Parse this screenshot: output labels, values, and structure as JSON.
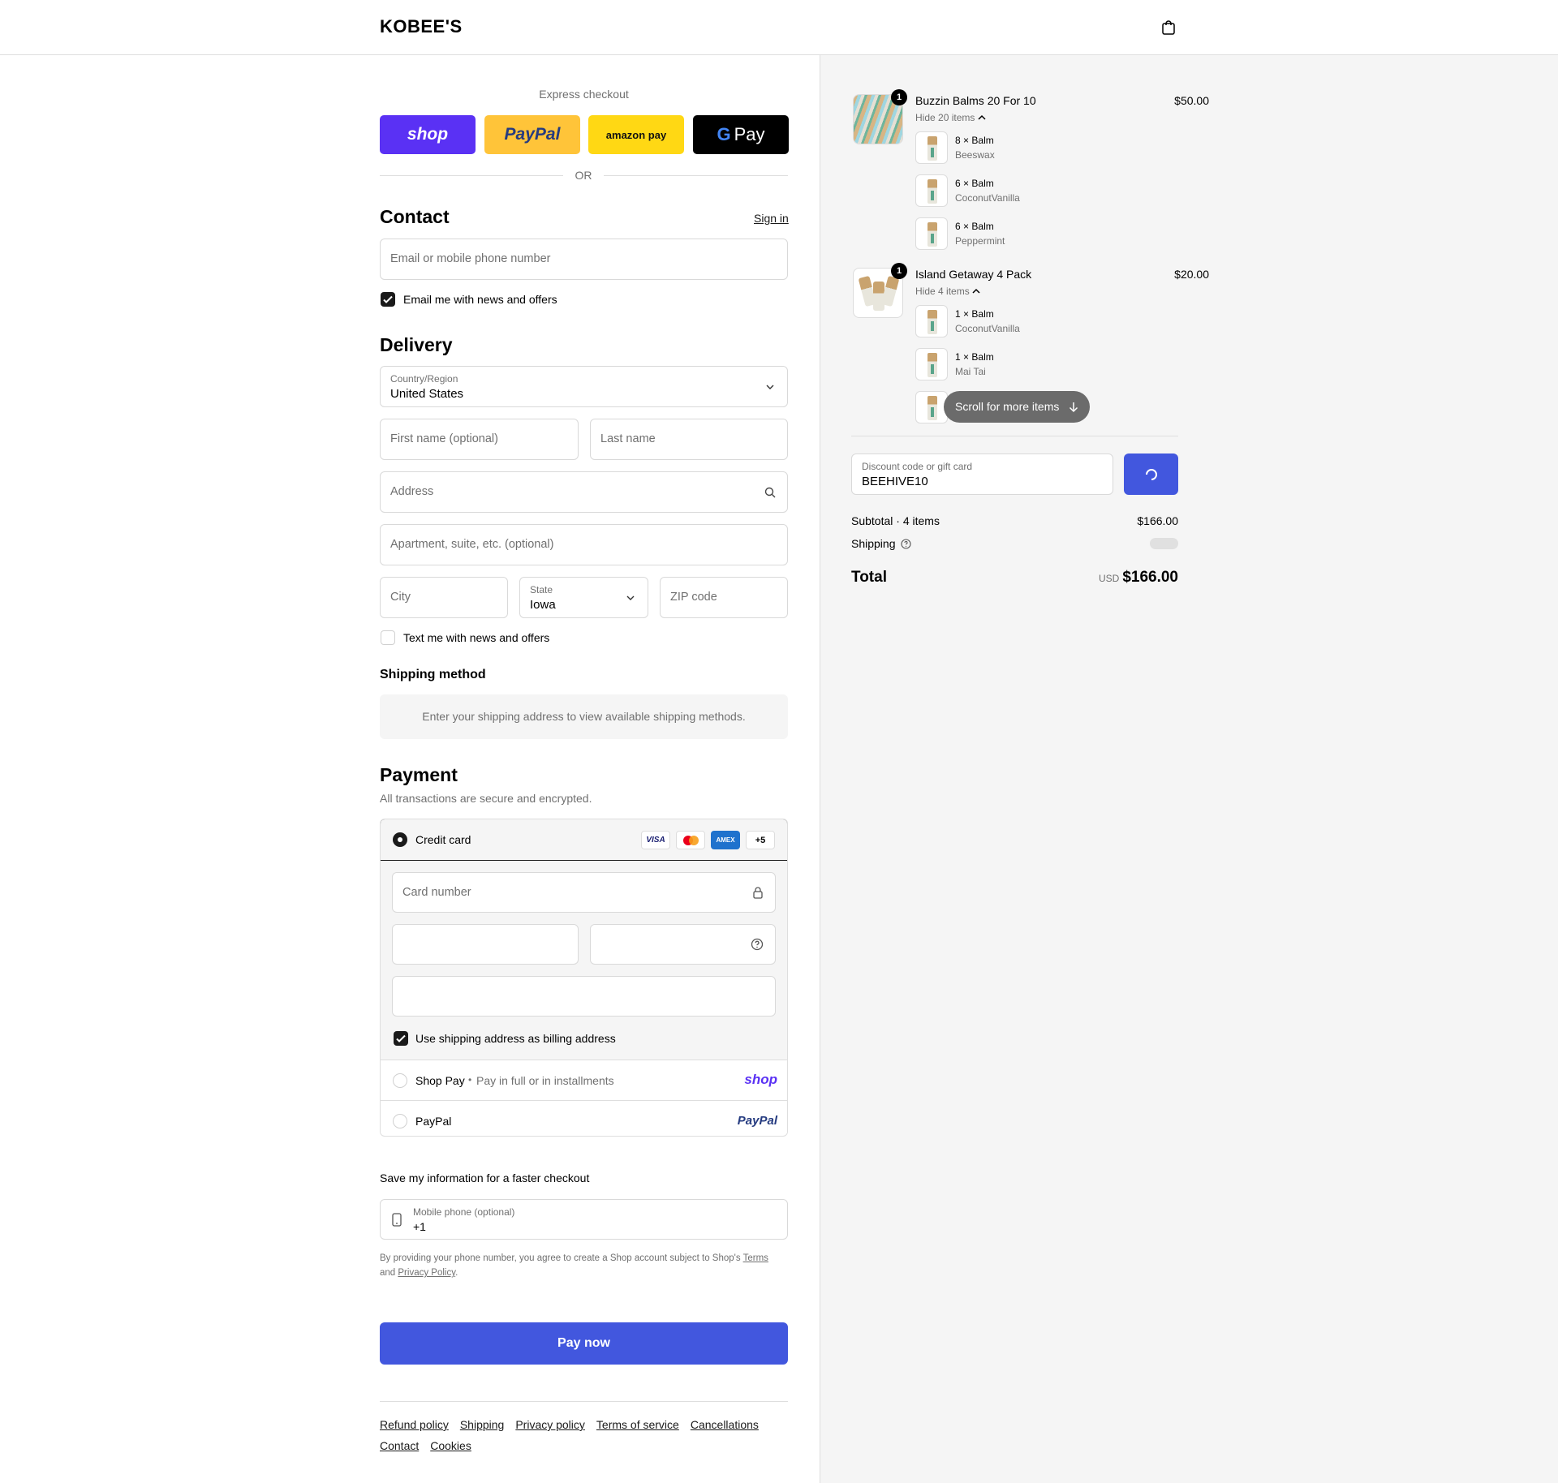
{
  "header": {
    "brand": "KOBEE'S"
  },
  "express": {
    "title": "Express checkout",
    "buttons": {
      "shop": "shop",
      "paypal": "PayPal",
      "amazon": "amazon pay",
      "gpay": "Pay"
    },
    "or": "OR"
  },
  "contact": {
    "title": "Contact",
    "sign_in": "Sign in",
    "email_placeholder": "Email or mobile phone number",
    "email_news": "Email me with news and offers",
    "email_news_checked": true
  },
  "delivery": {
    "title": "Delivery",
    "country_label": "Country/Region",
    "country_value": "United States",
    "first_name_placeholder": "First name (optional)",
    "last_name_placeholder": "Last name",
    "address_placeholder": "Address",
    "apartment_placeholder": "Apartment, suite, etc. (optional)",
    "city_placeholder": "City",
    "state_label": "State",
    "state_value": "Iowa",
    "zip_placeholder": "ZIP code",
    "text_news": "Text me with news and offers",
    "text_news_checked": false
  },
  "shipping_method": {
    "title": "Shipping method",
    "notice": "Enter your shipping address to view available shipping methods."
  },
  "payment": {
    "title": "Payment",
    "subtitle": "All transactions are secure and encrypted.",
    "credit_card": "Credit card",
    "card_brands": [
      "VISA",
      "MC",
      "AMEX",
      "+5"
    ],
    "card_number_placeholder": "Card number",
    "billing_same": "Use shipping address as billing address",
    "billing_same_checked": true,
    "shop_pay": "Shop Pay",
    "shop_pay_sep": "•",
    "shop_pay_desc": "Pay in full or in installments",
    "shop_pay_logo": "shop",
    "paypal": "PayPal",
    "paypal_logo": "PayPal"
  },
  "save_info": {
    "title": "Save my information for a faster checkout",
    "phone_label": "Mobile phone (optional)",
    "phone_value": "+1",
    "legal_prefix": "By providing your phone number, you agree to create a Shop account subject to Shop's",
    "terms": "Terms",
    "and": "and",
    "privacy": "Privacy Policy",
    "period": "."
  },
  "pay_now": "Pay now",
  "footer_links": [
    "Refund policy",
    "Shipping",
    "Privacy policy",
    "Terms of service",
    "Cancellations",
    "Contact",
    "Cookies"
  ],
  "order": {
    "items": [
      {
        "name": "Buzzin Balms 20 For 10",
        "price": "$50.00",
        "qty": "1",
        "toggle": "Hide 20 items",
        "sub": [
          {
            "qty": "8",
            "name": "Balm",
            "variant": "Beeswax"
          },
          {
            "qty": "6",
            "name": "Balm",
            "variant": "CoconutVanilla"
          },
          {
            "qty": "6",
            "name": "Balm",
            "variant": "Peppermint"
          }
        ]
      },
      {
        "name": "Island Getaway 4 Pack",
        "price": "$20.00",
        "qty": "1",
        "toggle": "Hide 4 items",
        "sub": [
          {
            "qty": "1",
            "name": "Balm",
            "variant": "CoconutVanilla"
          },
          {
            "qty": "1",
            "name": "Balm",
            "variant": "Mai Tai"
          }
        ]
      }
    ],
    "times": "×",
    "scroll_more": "Scroll for more items",
    "discount_label": "Discount code or gift card",
    "discount_value": "BEEHIVE10",
    "subtotal_label": "Subtotal · 4 items",
    "subtotal_value": "$166.00",
    "shipping_label": "Shipping",
    "total_label": "Total",
    "currency": "USD",
    "total_value": "$166.00"
  },
  "colors": {
    "accent": "#4257de",
    "shop_purple": "#5a31f4",
    "paypal_yellow": "#ffc439",
    "amazon_yellow": "#ffd814"
  }
}
